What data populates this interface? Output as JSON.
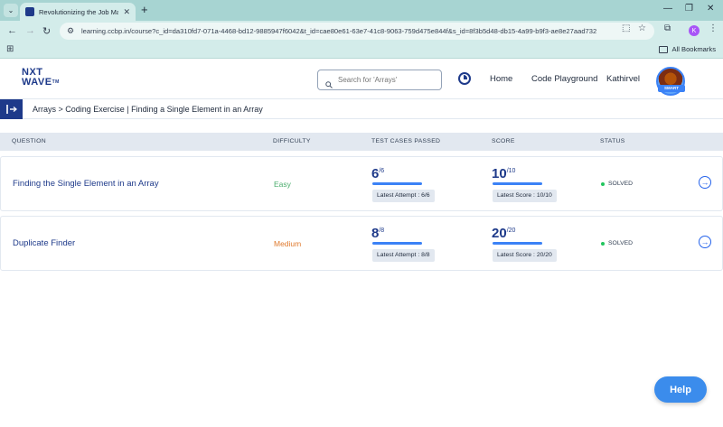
{
  "browser": {
    "tab_title": "Revolutionizing the Job Market |",
    "url": "learning.ccbp.in/course?c_id=da310fd7-071a-4468-bd12-9885947f6042&t_id=cae80e61-63e7-41c8-9063-759d475e844f&s_id=8f3b5d48-db15-4a99-b9f3-ae8e27aad732",
    "profile_initial": "K",
    "bookmarks_label": "All Bookmarks"
  },
  "header": {
    "logo_line1": "NXT",
    "logo_line2": "WAVE",
    "logo_tm": "TM",
    "search_placeholder": "Search for 'Arrays'",
    "nav": {
      "home": "Home",
      "playground": "Code Playground",
      "user": "Kathirvel"
    },
    "avatar_badge": "SMART"
  },
  "breadcrumb": "Arrays > Coding Exercise | Finding a Single Element in an Array",
  "table": {
    "headers": [
      "QUESTION",
      "DIFFICULTY",
      "TEST CASES PASSED",
      "SCORE",
      "STATUS"
    ],
    "rows": [
      {
        "question": "Finding the Single Element in an Array",
        "difficulty": "Easy",
        "difficulty_color": "#4cae6e",
        "passed": "6",
        "passed_total": "/6",
        "attempt": "Latest Attempt : 6/6",
        "score": "10",
        "score_total": "/10",
        "score_label": "Latest Score : 10/10",
        "status": "SOLVED"
      },
      {
        "question": "Duplicate Finder",
        "difficulty": "Medium",
        "difficulty_color": "#e07b2f",
        "passed": "8",
        "passed_total": "/8",
        "attempt": "Latest Attempt : 8/8",
        "score": "20",
        "score_total": "/20",
        "score_label": "Latest Score : 20/20",
        "status": "SOLVED"
      }
    ]
  },
  "help_label": "Help"
}
